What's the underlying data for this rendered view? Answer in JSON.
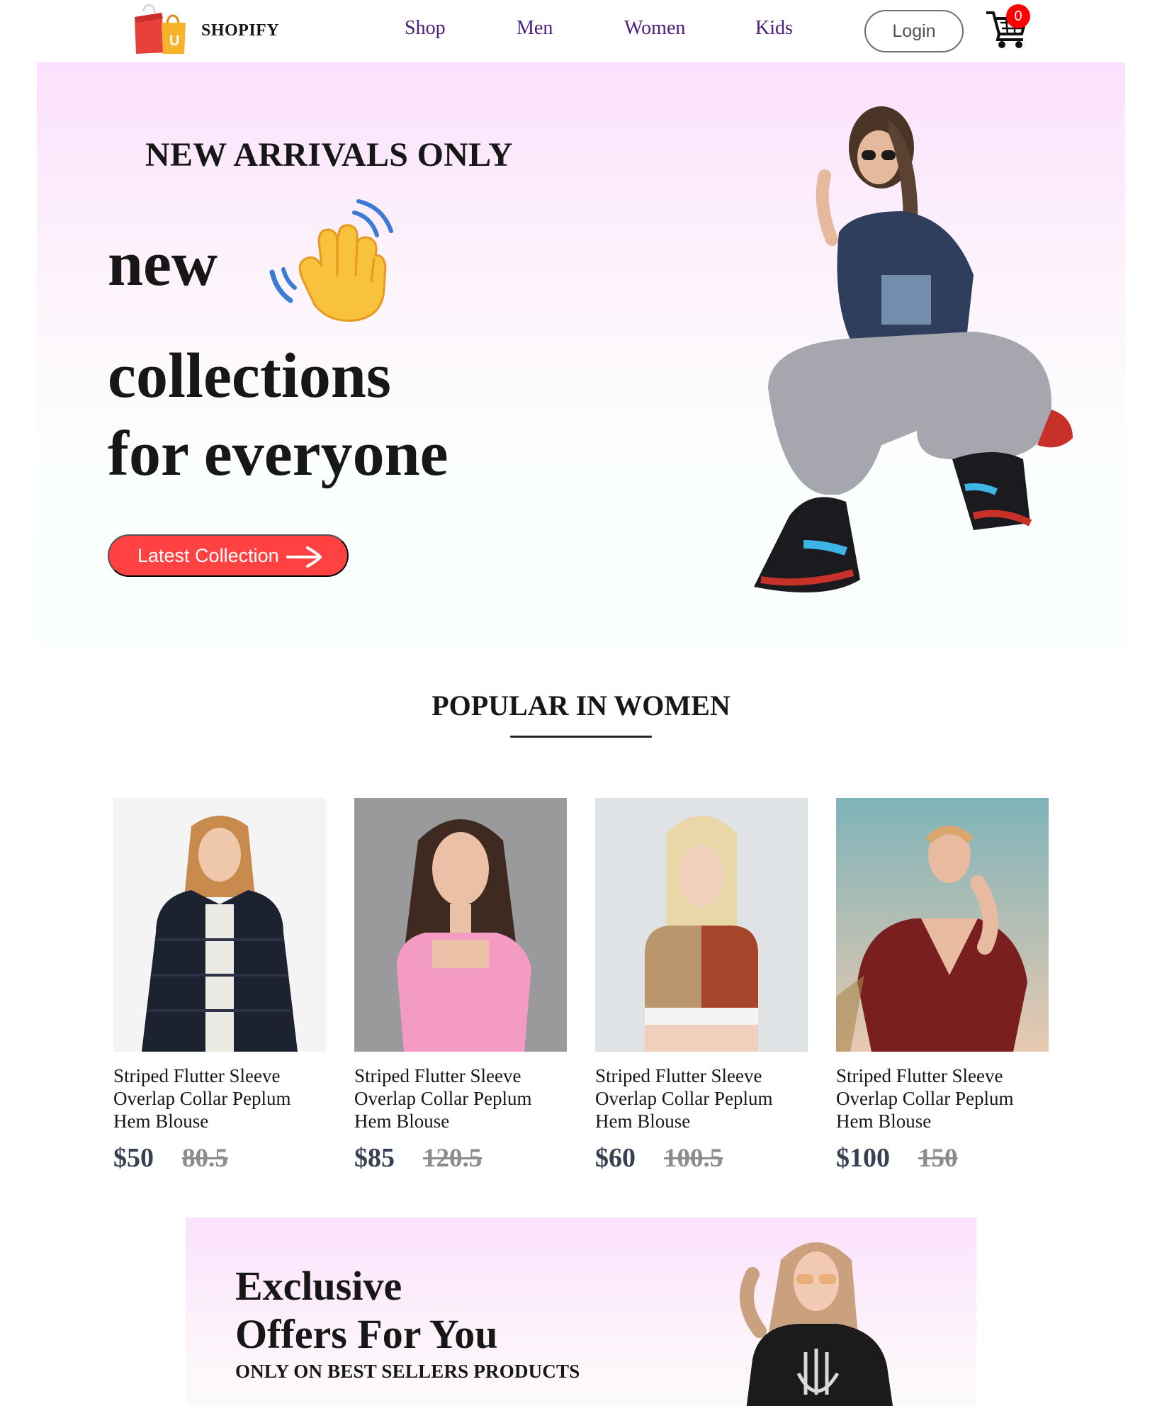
{
  "nav": {
    "brand": "SHOPIFY",
    "links": [
      "Shop",
      "Men",
      "Women",
      "Kids"
    ],
    "login_label": "Login",
    "cart_count": "0"
  },
  "hero": {
    "kicker": "NEW ARRIVALS ONLY",
    "line1": "new",
    "line2": "collections",
    "line3": "for everyone",
    "cta_label": "Latest Collection"
  },
  "popular": {
    "title": "POPULAR IN WOMEN",
    "products": [
      {
        "name": "Striped Flutter Sleeve Overlap Collar Peplum Hem Blouse",
        "new_price": "$50",
        "old_price": "80.5"
      },
      {
        "name": "Striped Flutter Sleeve Overlap Collar Peplum Hem Blouse",
        "new_price": "$85",
        "old_price": "120.5"
      },
      {
        "name": "Striped Flutter Sleeve Overlap Collar Peplum Hem Blouse",
        "new_price": "$60",
        "old_price": "100.5"
      },
      {
        "name": "Striped Flutter Sleeve Overlap Collar Peplum Hem Blouse",
        "new_price": "$100",
        "old_price": "150"
      }
    ]
  },
  "offers": {
    "title_line1": "Exclusive",
    "title_line2": "Offers For You",
    "subtitle": "ONLY ON BEST SELLERS PRODUCTS"
  },
  "colors": {
    "accent_red": "#ff4141",
    "nav_link": "#4b1d7e",
    "hero_gradient_top": "#fbe1fd",
    "badge_red": "#ff0000"
  }
}
